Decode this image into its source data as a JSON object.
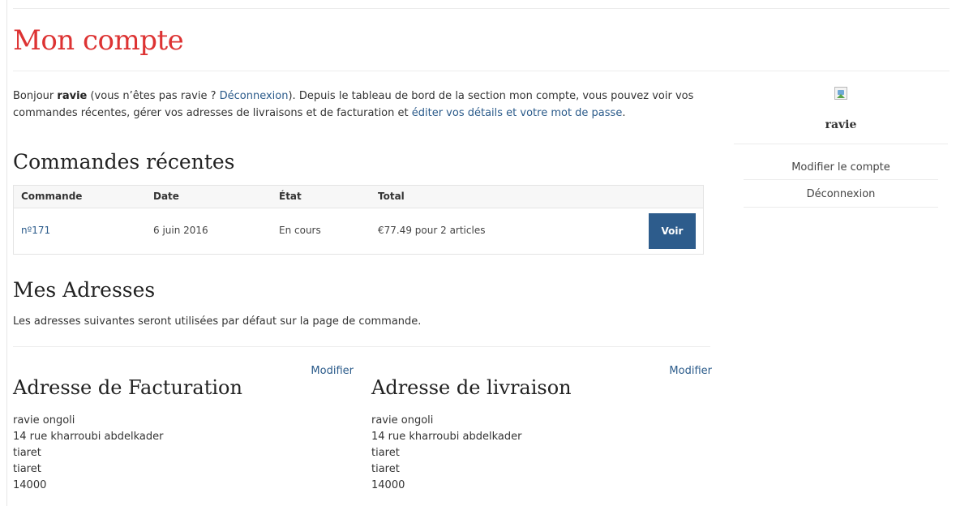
{
  "page": {
    "title": "Mon compte"
  },
  "intro": {
    "p1": "Bonjour ",
    "username": "ravie",
    "p2": " (vous n’êtes pas ravie ? ",
    "logout_link": "Déconnexion",
    "p3": "). Depuis le tableau de bord de la section mon compte, vous pouvez voir vos commandes récentes, gérer vos adresses de livraisons et de facturation et ",
    "edit_link": "éditer vos détails et votre mot de passe",
    "p4": "."
  },
  "orders": {
    "heading": "Commandes récentes",
    "columns": [
      "Commande",
      "Date",
      "État",
      "Total"
    ],
    "rows": [
      {
        "number": "nº171",
        "date": "6 juin 2016",
        "status": "En cours",
        "total": "€77.49 pour 2 articles",
        "action": "Voir"
      }
    ]
  },
  "addresses": {
    "heading": "Mes Adresses",
    "description": "Les adresses suivantes seront utilisées par défaut sur la page de commande.",
    "billing": {
      "title": "Adresse de Facturation",
      "edit_label": "Modifier",
      "lines": [
        "ravie ongoli",
        "14 rue kharroubi abdelkader",
        "tiaret",
        "tiaret",
        "14000"
      ]
    },
    "shipping": {
      "title": "Adresse de livraison",
      "edit_label": "Modifier",
      "lines": [
        "ravie ongoli",
        "14 rue kharroubi abdelkader",
        "tiaret",
        "tiaret",
        "14000"
      ]
    }
  },
  "sidebar": {
    "avatar_icon": "broken-image-icon",
    "username": "ravie",
    "links": [
      "Modifier le compte",
      "Déconnexion"
    ]
  },
  "colors": {
    "title_red": "#dd3333",
    "link_blue": "#2a5a8a",
    "button_blue": "#2d5c8c"
  }
}
